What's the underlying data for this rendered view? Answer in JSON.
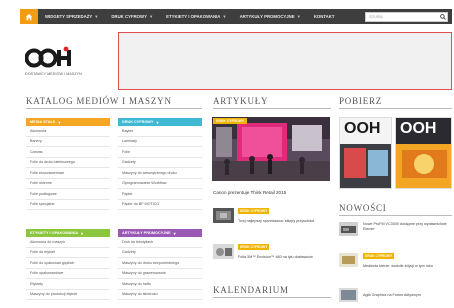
{
  "nav": {
    "items": [
      {
        "label": "WIDGETY SPRZEDAŻY",
        "dropdown": true
      },
      {
        "label": "DRUK CYFROWY",
        "dropdown": true
      },
      {
        "label": "ETYKIETY I OPAKOWANIA",
        "dropdown": true
      },
      {
        "label": "ARTYKUŁY PROMOCYJNE",
        "dropdown": true
      },
      {
        "label": "KONTAKT",
        "dropdown": false
      }
    ],
    "search_placeholder": "Szukaj",
    "caret": "▾"
  },
  "logo": {
    "text": "OOH",
    "tagline": "DOSTAWCY MEDIÓW I MASZYN"
  },
  "sections": {
    "catalog": "KATALOG MEDIÓW I MASZYN",
    "articles": "ARTYKUŁY",
    "download": "POBIERZ",
    "news": "NOWOŚCI",
    "calendar": "KALENDARIUM"
  },
  "categories": [
    {
      "title": "MEDIA STAŁE",
      "color": "#f5a623",
      "items": [
        "Akcesoria",
        "Banery",
        "Canvas",
        "Folie do druku lateksowego",
        "Folie ekosolwentowe",
        "Folie okienne",
        "Folie podłogowe",
        "Folie specjalne"
      ]
    },
    {
      "title": "DRUK CYFROWY",
      "color": "#3fb8d4",
      "items": [
        "Baytex",
        "Laminaty",
        "Folie",
        "Gadżety",
        "Maszyny do wewnętrznego druku",
        "Oprogramowanie Workflow",
        "Papier",
        "Papier do BF MOTICO"
      ]
    },
    {
      "title": "ETYKIETY I OPAKOWANIA",
      "color": "#8cc63f",
      "items": [
        "Akcesoria do maszyn",
        "Folie do etykiet",
        "Folie do opakowań giętkich",
        "Folie opakowaniowe",
        "Etykiety",
        "Maszyny do produkcji etykiet"
      ]
    },
    {
      "title": "ARTYKUŁY PROMOCYJNE",
      "color": "#9b59b6",
      "items": [
        "Druk na tekstyliach",
        "Gadżety",
        "Maszyny do druku bezpośredniego",
        "Maszyny do grawerowania",
        "Maszyny do haftu",
        "Maszyny do sitodruku"
      ]
    }
  ],
  "articles": {
    "main_badge": "DRUK CYFROWY",
    "main_caption": "Canon prezentuje Think Retail 2015",
    "items": [
      {
        "badge": "DRUK CYFROWY",
        "text": "Twój najlepszy sprzedawca: sklepy przyszłości"
      },
      {
        "badge": "DRUK CYFROWY",
        "text": "Folia 3M™ Envision™ 480 na tyłu dostawców"
      }
    ]
  },
  "news": [
    {
      "text": "Nowe ProFM VC3000 dostępne przy wydawnictwie Elemer"
    },
    {
      "badge": "DRUK CYFROWY",
      "text": "Medienta bierze: wsiedle edycji w tym roku"
    },
    {
      "text": "Agfa Graphics na Forum Aktywnym"
    }
  ],
  "download": {
    "cover1": "OOH",
    "cover2": "OOH"
  }
}
